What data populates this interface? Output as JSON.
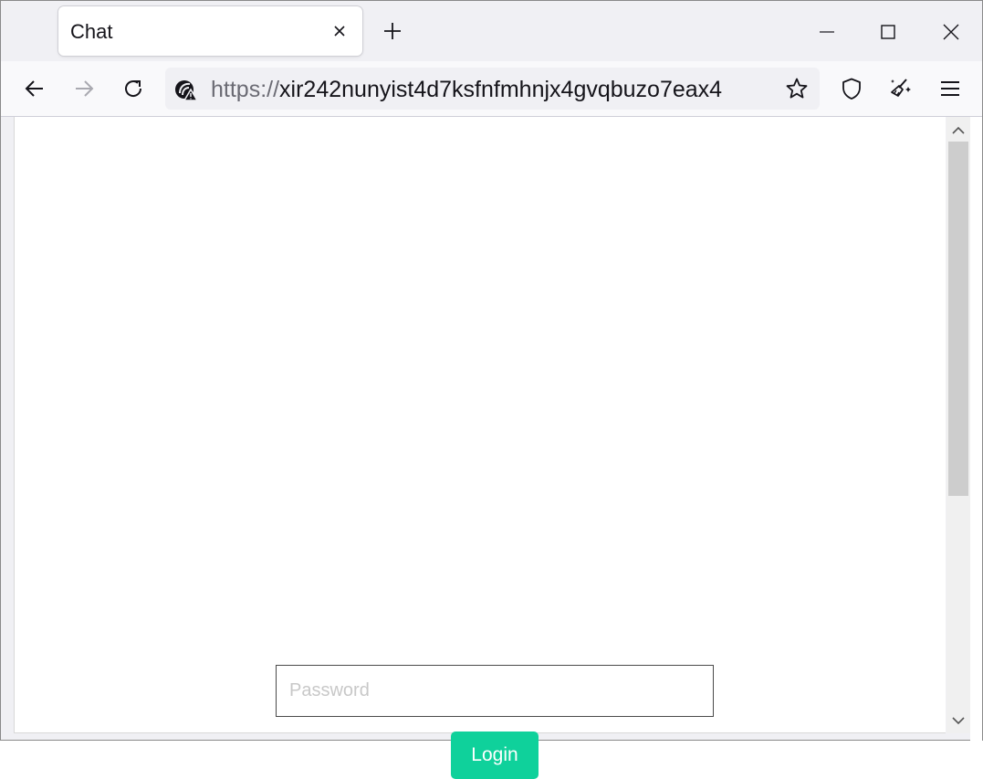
{
  "browser": {
    "tab": {
      "title": "Chat"
    },
    "url": {
      "scheme": "https://",
      "rest": "xir242nunyist4d7ksfnfmhnjx4gvqbuzo7eax4"
    },
    "icons": {
      "tab_close": "close-icon",
      "new_tab": "plus-icon",
      "minimize": "minimize-icon",
      "maximize": "maximize-icon",
      "close_window": "close-icon",
      "back": "arrow-left-icon",
      "forward": "arrow-right-icon",
      "reload": "reload-icon",
      "site_info": "insecure-lock-icon",
      "bookmark": "star-icon",
      "tracking_protection": "shield-icon",
      "extensions": "broom-sparkle-icon",
      "app_menu": "hamburger-menu-icon"
    }
  },
  "page": {
    "password_placeholder": "Password",
    "password_value": "",
    "login_label": "Login"
  },
  "colors": {
    "accent": "#0fd19b",
    "chrome_bg": "#f0f0f4",
    "toolbar_bg": "#f9f9fb"
  }
}
